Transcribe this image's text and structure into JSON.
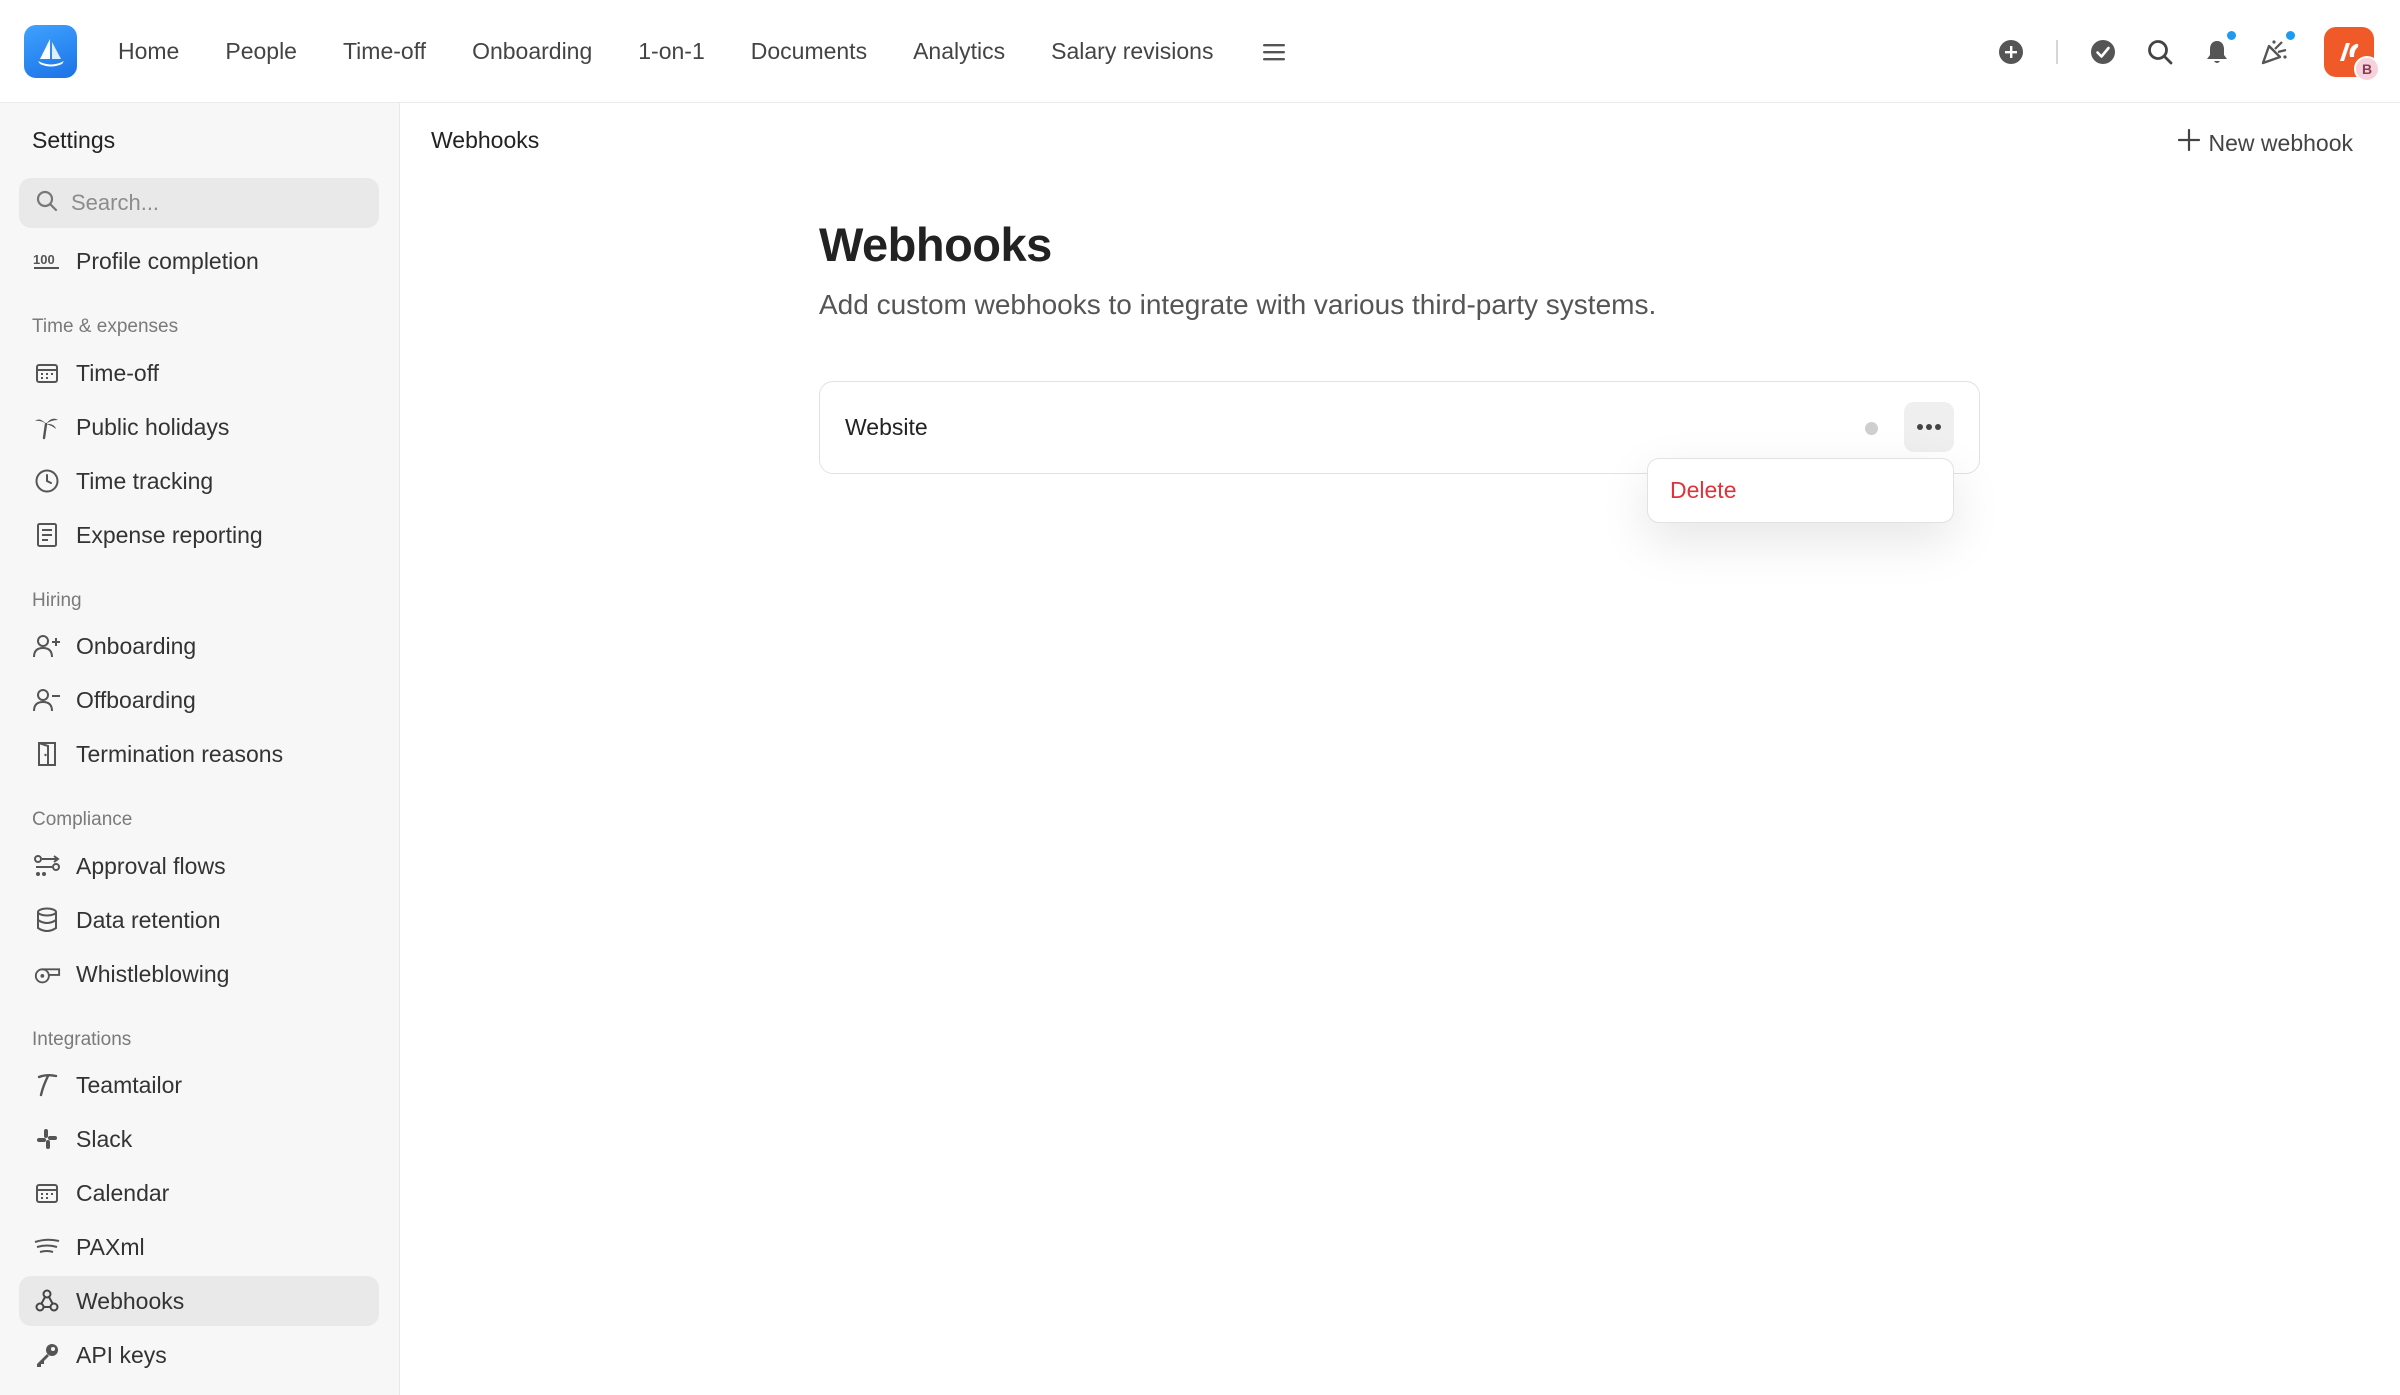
{
  "topnav": {
    "items": [
      {
        "label": "Home"
      },
      {
        "label": "People"
      },
      {
        "label": "Time-off"
      },
      {
        "label": "Onboarding"
      },
      {
        "label": "1-on-1"
      },
      {
        "label": "Documents"
      },
      {
        "label": "Analytics"
      },
      {
        "label": "Salary revisions"
      }
    ],
    "menu_icon": "hamburger-icon",
    "right_icons": [
      "add-circle-icon",
      "check-circle-icon",
      "search-icon",
      "bell-icon",
      "celebration-icon"
    ],
    "avatar_badge": "B"
  },
  "sidebar": {
    "title": "Settings",
    "search_placeholder": "Search...",
    "top_item": {
      "label": "Profile completion",
      "icon": "100-icon"
    },
    "sections": [
      {
        "title": "Time & expenses",
        "items": [
          {
            "label": "Time-off",
            "icon": "calendar-icon"
          },
          {
            "label": "Public holidays",
            "icon": "palm-tree-icon"
          },
          {
            "label": "Time tracking",
            "icon": "clock-icon"
          },
          {
            "label": "Expense reporting",
            "icon": "receipt-icon"
          }
        ]
      },
      {
        "title": "Hiring",
        "items": [
          {
            "label": "Onboarding",
            "icon": "user-plus-icon"
          },
          {
            "label": "Offboarding",
            "icon": "user-minus-icon"
          },
          {
            "label": "Termination reasons",
            "icon": "door-icon"
          }
        ]
      },
      {
        "title": "Compliance",
        "items": [
          {
            "label": "Approval flows",
            "icon": "flow-icon"
          },
          {
            "label": "Data retention",
            "icon": "database-icon"
          },
          {
            "label": "Whistleblowing",
            "icon": "whistle-icon"
          }
        ]
      },
      {
        "title": "Integrations",
        "items": [
          {
            "label": "Teamtailor",
            "icon": "teamtailor-icon"
          },
          {
            "label": "Slack",
            "icon": "slack-icon"
          },
          {
            "label": "Calendar",
            "icon": "calendar-icon"
          },
          {
            "label": "PAXml",
            "icon": "paxml-icon"
          },
          {
            "label": "Webhooks",
            "icon": "webhook-icon",
            "active": true
          },
          {
            "label": "API keys",
            "icon": "key-icon"
          }
        ]
      }
    ]
  },
  "main": {
    "breadcrumb": "Webhooks",
    "new_button": "New webhook",
    "title": "Webhooks",
    "subtitle": "Add custom webhooks to integrate with various third-party systems.",
    "webhooks": [
      {
        "name": "Website",
        "status_color": "#cfcfcf"
      }
    ],
    "dropdown": {
      "items": [
        {
          "label": "Delete",
          "color": "#e0323a"
        }
      ]
    }
  },
  "colors": {
    "accent": "#1e9bf0",
    "danger": "#e0323a",
    "avatar": "#f05a28"
  }
}
